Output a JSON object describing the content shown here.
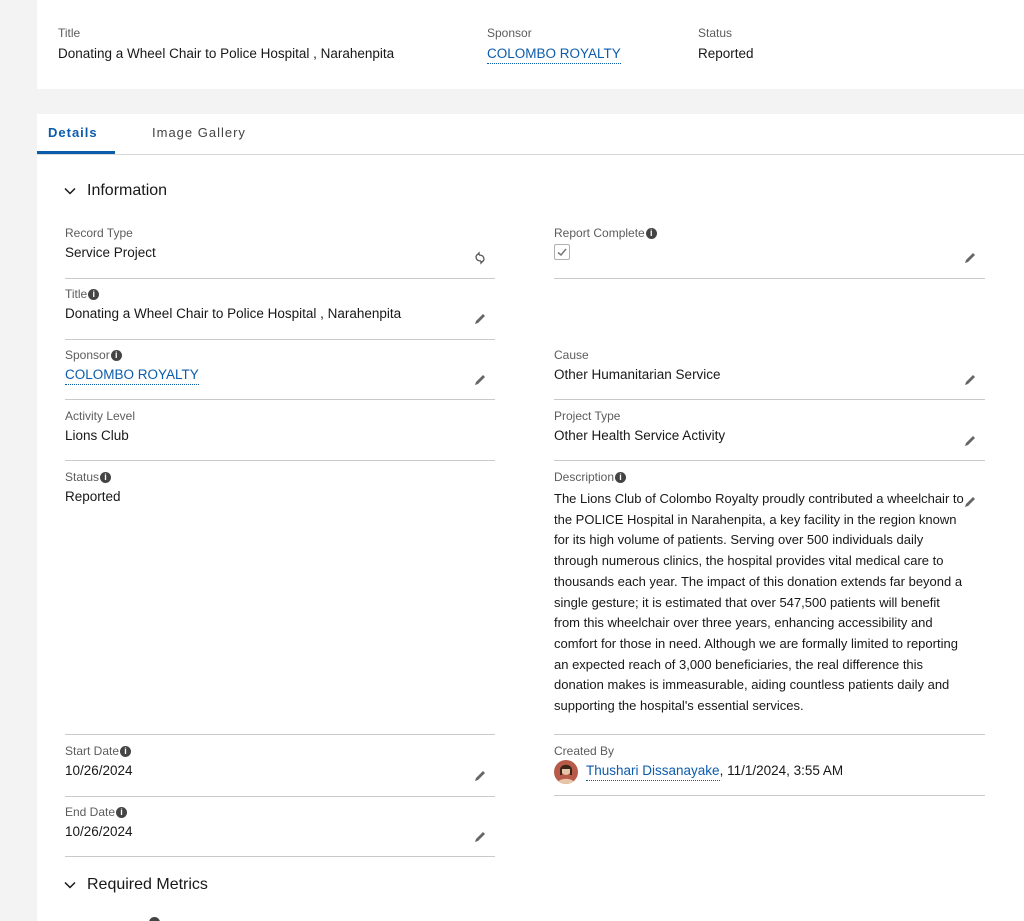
{
  "header": {
    "title_label": "Title",
    "title_value": "Donating a Wheel Chair to Police Hospital , Narahenpita",
    "sponsor_label": "Sponsor",
    "sponsor_value": "COLOMBO ROYALTY",
    "status_label": "Status",
    "status_value": "Reported"
  },
  "tabs": [
    {
      "label": "Details",
      "active": true
    },
    {
      "label": "Image Gallery",
      "active": false
    }
  ],
  "sections": {
    "information": "Information",
    "required_metrics": "Required Metrics"
  },
  "fields": {
    "record_type": {
      "label": "Record Type",
      "value": "Service Project"
    },
    "report_complete": {
      "label": "Report Complete",
      "checked": true
    },
    "title": {
      "label": "Title",
      "value": "Donating a Wheel Chair to Police Hospital , Narahenpita"
    },
    "sponsor": {
      "label": "Sponsor",
      "value": "COLOMBO ROYALTY"
    },
    "cause": {
      "label": "Cause",
      "value": "Other Humanitarian Service"
    },
    "activity_level": {
      "label": "Activity Level",
      "value": "Lions Club"
    },
    "project_type": {
      "label": "Project Type",
      "value": "Other Health Service Activity"
    },
    "status": {
      "label": "Status",
      "value": "Reported"
    },
    "description": {
      "label": "Description",
      "value": "The Lions Club of Colombo Royalty proudly contributed a wheelchair to the POLICE Hospital in Narahenpita, a key facility in the region known for its high volume of patients. Serving over 500 individuals daily through numerous clinics, the hospital provides vital medical care to thousands each year. The impact of this donation extends far beyond a single gesture; it is estimated that over 547,500 patients will benefit from this wheelchair over three years, enhancing accessibility and comfort for those in need. Although we are formally limited to reporting an expected reach of 3,000 beneficiaries, the real difference this donation makes is immeasurable, aiding countless patients daily and supporting the hospital's essential services."
    },
    "start_date": {
      "label": "Start Date",
      "value": "10/26/2024"
    },
    "created_by": {
      "label": "Created By",
      "user": "Thushari Dissanayake",
      "timestamp": ", 11/1/2024, 3:55 AM"
    },
    "end_date": {
      "label": "End Date",
      "value": "10/26/2024"
    }
  },
  "colors": {
    "link": "#0b5cab",
    "accent": "#0b5cab",
    "label": "#5c5c5c"
  }
}
